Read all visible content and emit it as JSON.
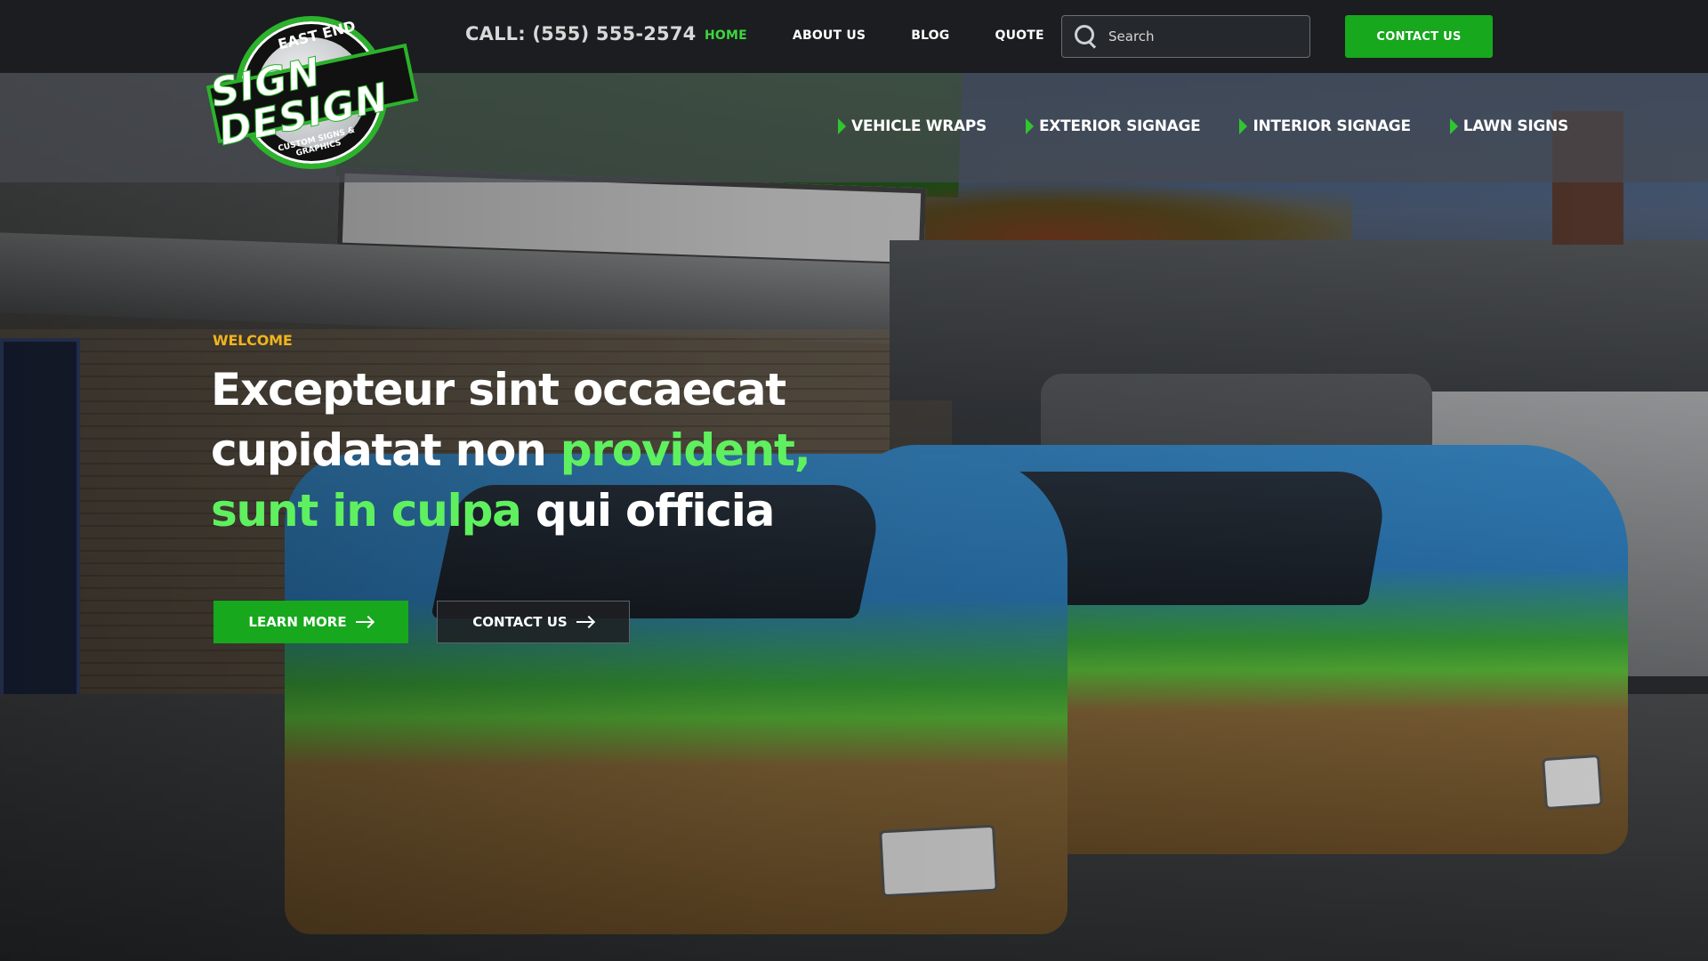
{
  "brand": {
    "logo_top": "EAST END",
    "logo_main": "SIGN DESIGN",
    "logo_bottom": "CUSTOM SIGNS & GRAPHICS"
  },
  "header": {
    "phone": "CALL: (555) 555-2574",
    "nav": [
      {
        "label": "HOME",
        "active": true
      },
      {
        "label": "ABOUT US",
        "active": false
      },
      {
        "label": "BLOG",
        "active": false
      },
      {
        "label": "QUOTE",
        "active": false
      }
    ],
    "search_placeholder": "Search",
    "contact_button": "CONTACT US"
  },
  "subnav": [
    {
      "label": "VEHICLE WRAPS"
    },
    {
      "label": "EXTERIOR SIGNAGE"
    },
    {
      "label": "INTERIOR SIGNAGE"
    },
    {
      "label": "LAWN SIGNS"
    }
  ],
  "hero": {
    "eyebrow": "WELCOME",
    "headline_part1": "Excepteur sint occaecat cupidatat non ",
    "headline_green": "provident, sunt in culpa",
    "headline_part2": " qui officia",
    "learn_more": "LEARN MORE",
    "contact": "CONTACT US"
  },
  "colors": {
    "accent_green": "#17a81d",
    "headline_green": "#5ff05f",
    "eyebrow_yellow": "#f0b41c",
    "topbar_bg": "#1b1d20"
  }
}
